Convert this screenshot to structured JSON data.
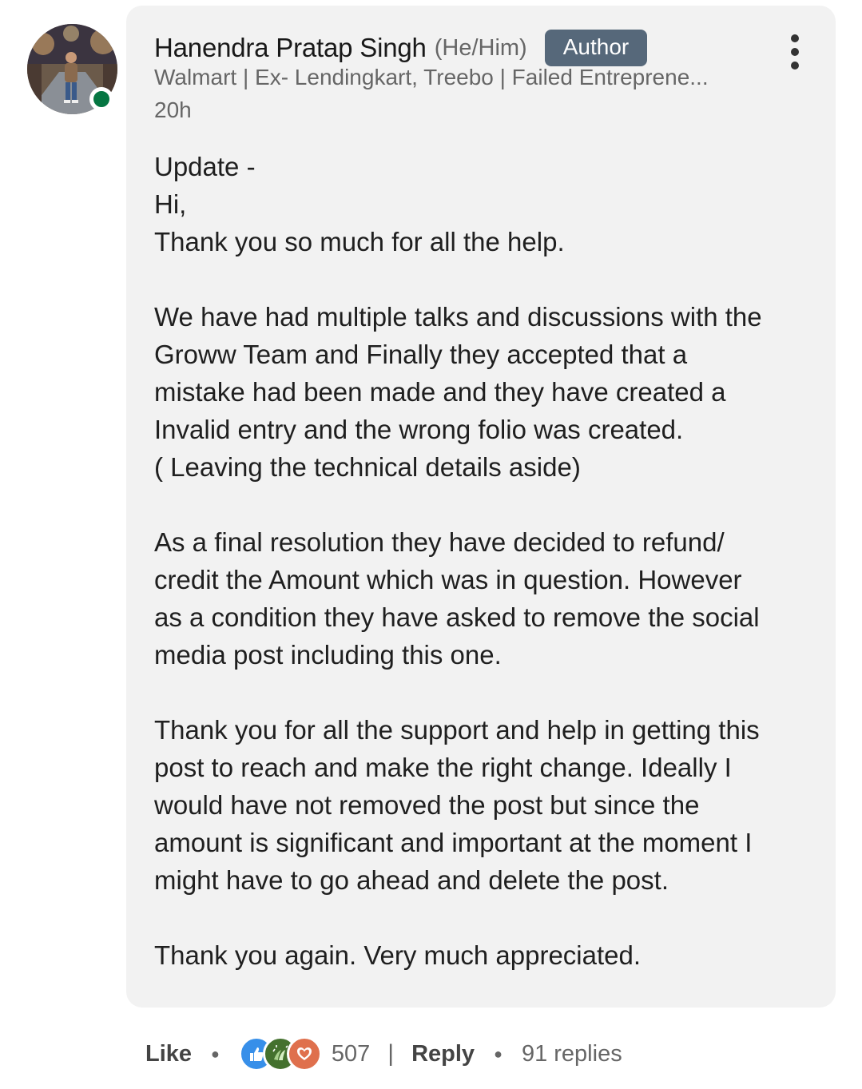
{
  "comment": {
    "author": {
      "name": "Hanendra Pratap Singh",
      "pronouns": "(He/Him)",
      "badge": "Author",
      "headline": "Walmart | Ex- Lendingkart, Treebo | Failed Entreprene...",
      "online": true
    },
    "timestamp": "20h",
    "body": [
      "Update -\nHi,\nThank you so much for all the help.",
      "We have had multiple talks and discussions with the\nGroww Team and Finally they accepted that a\nmistake had been made and they have created a\nInvalid entry and the wrong folio was created.\n( Leaving the technical details aside)",
      "As a final resolution they have decided to refund/\ncredit the Amount which was in question. However\nas a condition they have asked to remove the social\nmedia post including this one.",
      "Thank you for all the support and help in getting this\npost to reach and make the right change. Ideally I\nwould have not removed the post but since the\namount is significant and important at the moment I\nmight have to go ahead and delete the post.",
      "Thank you again. Very much appreciated."
    ]
  },
  "actions": {
    "like_label": "Like",
    "reactions": [
      "like-icon",
      "celebrate-icon",
      "love-icon"
    ],
    "reaction_count": "507",
    "reply_label": "Reply",
    "replies_count": "91 replies"
  },
  "colors": {
    "card_background": "#f2f2f2",
    "badge_background": "#56687a",
    "online_dot": "#057642",
    "like_blue": "#378fe9",
    "celebrate_green": "#44712e",
    "love_red": "#df704d"
  }
}
